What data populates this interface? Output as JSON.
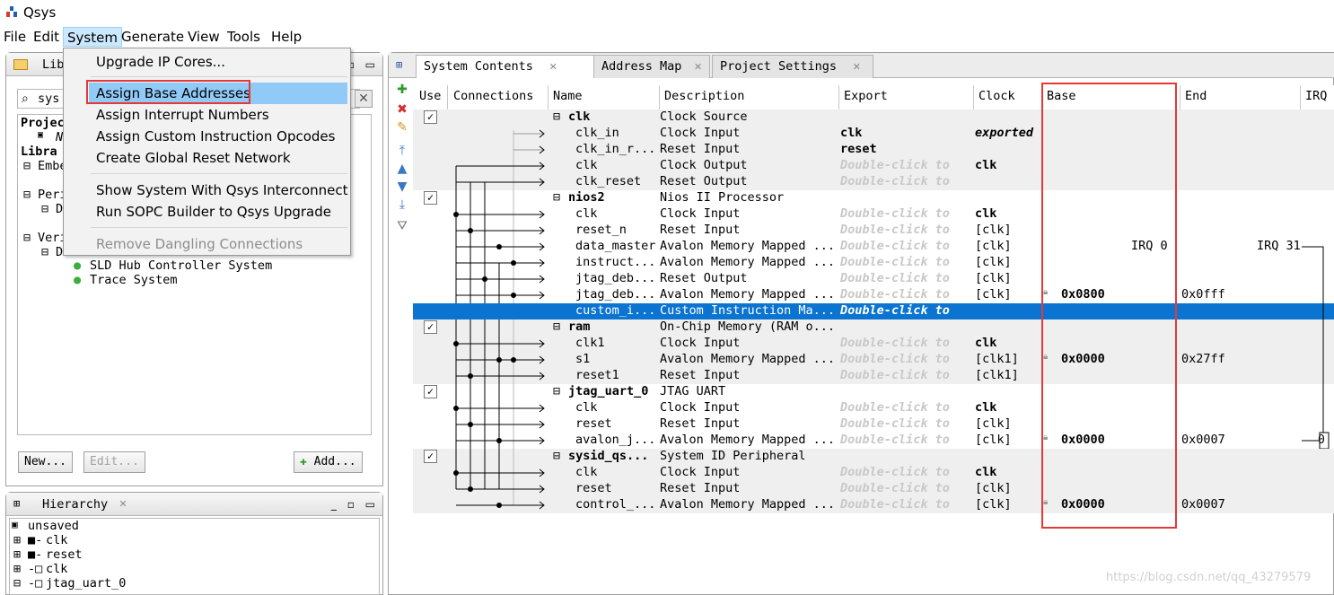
{
  "app": {
    "title": "Qsys"
  },
  "menubar": {
    "items": [
      "File",
      "Edit",
      "System",
      "Generate",
      "View",
      "Tools",
      "Help"
    ]
  },
  "system_menu": {
    "items": [
      "Upgrade IP Cores...",
      "Assign Base Addresses",
      "Assign Interrupt Numbers",
      "Assign Custom Instruction Opcodes",
      "Create Global Reset Network",
      "Show System With Qsys Interconnect",
      "Run SOPC Builder to Qsys Upgrade",
      "Remove Dangling Connections"
    ],
    "highlighted": "Assign Base Addresses",
    "disabled": "Remove Dangling Connections"
  },
  "library": {
    "tab_title": "Lib",
    "search_value": "sys",
    "tree": [
      "Projec",
      "N",
      "Libra",
      "Embe",
      "Peri",
      "De",
      "Veri",
      "De",
      "SLD Hub Controller System",
      "Trace System"
    ],
    "buttons": {
      "new": "New...",
      "edit": "Edit...",
      "add": "Add..."
    }
  },
  "hierarchy": {
    "tab_title": "Hierarchy",
    "items": [
      "unsaved",
      "clk",
      "reset",
      "clk",
      "jtag_uart_0"
    ]
  },
  "system_contents": {
    "tabs": [
      "System Contents",
      "Address Map",
      "Project Settings"
    ],
    "columns": [
      "Use",
      "Connections",
      "Name",
      "Description",
      "Export",
      "Clock",
      "Base",
      "End",
      "IRQ"
    ],
    "rows": [
      {
        "use": true,
        "name": "clk",
        "desc": "Clock Source",
        "export": "",
        "clock": "",
        "base": "",
        "end": "",
        "group": true
      },
      {
        "name": "clk_in",
        "desc": "Clock Input",
        "export": "clk",
        "clock": "exported",
        "base": "",
        "end": ""
      },
      {
        "name": "clk_in_r...",
        "desc": "Reset Input",
        "export": "reset",
        "clock": "",
        "base": "",
        "end": ""
      },
      {
        "name": "clk",
        "desc": "Clock Output",
        "export": "Double-click to",
        "clock": "clk",
        "base": "",
        "end": ""
      },
      {
        "name": "clk_reset",
        "desc": "Reset Output",
        "export": "Double-click to",
        "clock": "",
        "base": "",
        "end": ""
      },
      {
        "use": true,
        "name": "nios2",
        "desc": "Nios II Processor",
        "export": "",
        "clock": "",
        "base": "",
        "end": "",
        "group": true
      },
      {
        "name": "clk",
        "desc": "Clock Input",
        "export": "Double-click to",
        "clock": "clk",
        "base": "",
        "end": ""
      },
      {
        "name": "reset_n",
        "desc": "Reset Input",
        "export": "Double-click to",
        "clock": "[clk]",
        "base": "",
        "end": ""
      },
      {
        "name": "data_master",
        "desc": "Avalon Memory Mapped ...",
        "export": "Double-click to",
        "clock": "[clk]",
        "base": "IRQ 0",
        "end": "IRQ 31"
      },
      {
        "name": "instruct...",
        "desc": "Avalon Memory Mapped ...",
        "export": "Double-click to",
        "clock": "[clk]",
        "base": "",
        "end": ""
      },
      {
        "name": "jtag_deb...",
        "desc": "Reset Output",
        "export": "Double-click to",
        "clock": "[clk]",
        "base": "",
        "end": ""
      },
      {
        "name": "jtag_deb...",
        "desc": "Avalon Memory Mapped ...",
        "export": "Double-click to",
        "clock": "[clk]",
        "base": "0x0800",
        "end": "0x0fff"
      },
      {
        "name": "custom_i...",
        "desc": "Custom Instruction Ma...",
        "export": "Double-click to",
        "clock": "",
        "base": "",
        "end": "",
        "selected": true
      },
      {
        "use": true,
        "name": "ram",
        "desc": "On-Chip Memory (RAM o...",
        "export": "",
        "clock": "",
        "base": "",
        "end": "",
        "group": true
      },
      {
        "name": "clk1",
        "desc": "Clock Input",
        "export": "Double-click to",
        "clock": "clk",
        "base": "",
        "end": ""
      },
      {
        "name": "s1",
        "desc": "Avalon Memory Mapped ...",
        "export": "Double-click to",
        "clock": "[clk1]",
        "base": "0x0000",
        "end": "0x27ff"
      },
      {
        "name": "reset1",
        "desc": "Reset Input",
        "export": "Double-click to",
        "clock": "[clk1]",
        "base": "",
        "end": ""
      },
      {
        "use": true,
        "name": "jtag_uart_0",
        "desc": "JTAG UART",
        "export": "",
        "clock": "",
        "base": "",
        "end": "",
        "group": true
      },
      {
        "name": "clk",
        "desc": "Clock Input",
        "export": "Double-click to",
        "clock": "clk",
        "base": "",
        "end": ""
      },
      {
        "name": "reset",
        "desc": "Reset Input",
        "export": "Double-click to",
        "clock": "[clk]",
        "base": "",
        "end": ""
      },
      {
        "name": "avalon_j...",
        "desc": "Avalon Memory Mapped ...",
        "export": "Double-click to",
        "clock": "[clk]",
        "base": "0x0000",
        "end": "0x0007",
        "irq": "0"
      },
      {
        "use": true,
        "name": "sysid_qs...",
        "desc": "System ID Peripheral",
        "export": "",
        "clock": "",
        "base": "",
        "end": "",
        "group": true
      },
      {
        "name": "clk",
        "desc": "Clock Input",
        "export": "Double-click to",
        "clock": "clk",
        "base": "",
        "end": ""
      },
      {
        "name": "reset",
        "desc": "Reset Input",
        "export": "Double-click to",
        "clock": "[clk]",
        "base": "",
        "end": ""
      },
      {
        "name": "control_...",
        "desc": "Avalon Memory Mapped ...",
        "export": "Double-click to",
        "clock": "[clk]",
        "base": "0x0000",
        "end": "0x0007"
      }
    ]
  },
  "watermark": "https://blog.csdn.net/qq_43279579",
  "colors": {
    "selected_row": "#0a74d0",
    "highlight_box": "#e53935",
    "menu_highlight": "#91c9f7"
  }
}
